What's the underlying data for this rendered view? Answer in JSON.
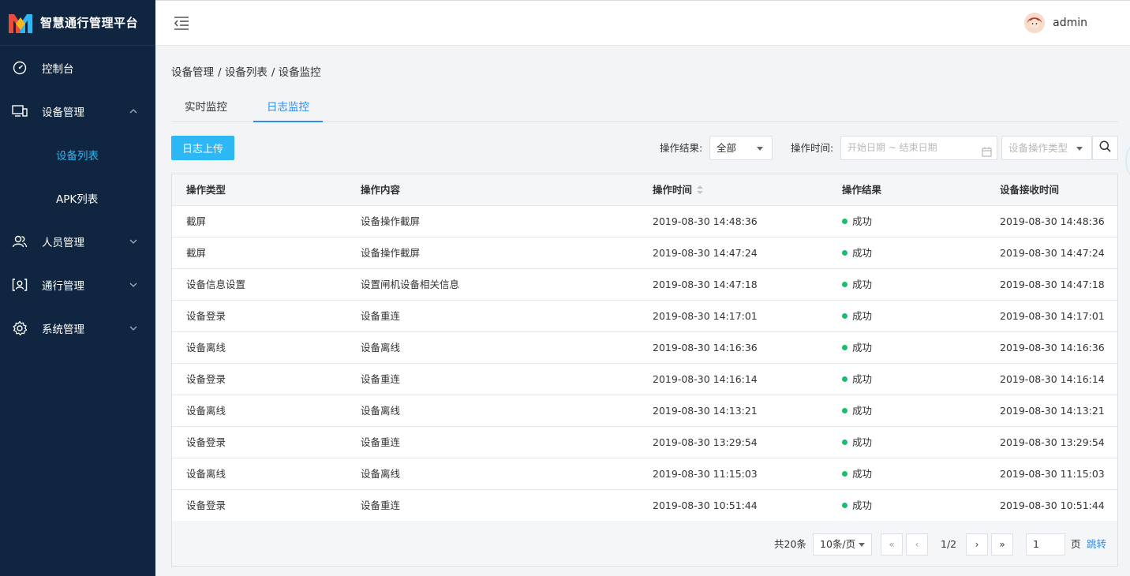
{
  "app": {
    "title": "智慧通行管理平台"
  },
  "sidebar": {
    "items": [
      {
        "label": "控制台",
        "icon": "dashboard-icon"
      },
      {
        "label": "设备管理",
        "icon": "devices-icon",
        "expanded": true,
        "children": [
          {
            "label": "设备列表",
            "active": true
          },
          {
            "label": "APK列表"
          }
        ]
      },
      {
        "label": "人员管理",
        "icon": "people-icon"
      },
      {
        "label": "通行管理",
        "icon": "access-icon"
      },
      {
        "label": "系统管理",
        "icon": "gear-icon"
      }
    ]
  },
  "header": {
    "user": "admin"
  },
  "breadcrumb": [
    "设备管理",
    "/ 设备列表",
    "/ 设备监控"
  ],
  "tabs": [
    {
      "label": "实时监控"
    },
    {
      "label": "日志监控",
      "active": true
    }
  ],
  "toolbar": {
    "upload_label": "日志上传",
    "result_label": "操作结果:",
    "result_value": "全部",
    "time_label": "操作时间:",
    "date_placeholder": "开始日期 ~ 结束日期",
    "type_placeholder": "设备操作类型"
  },
  "table": {
    "headers": [
      "操作类型",
      "操作内容",
      "操作时间",
      "操作结果",
      "设备接收时间"
    ],
    "rows": [
      [
        "截屏",
        "设备操作截屏",
        "2019-08-30 14:48:36",
        "成功",
        "2019-08-30 14:48:36"
      ],
      [
        "截屏",
        "设备操作截屏",
        "2019-08-30 14:47:24",
        "成功",
        "2019-08-30 14:47:24"
      ],
      [
        "设备信息设置",
        "设置闸机设备相关信息",
        "2019-08-30 14:47:18",
        "成功",
        "2019-08-30 14:47:18"
      ],
      [
        "设备登录",
        "设备重连",
        "2019-08-30 14:17:01",
        "成功",
        "2019-08-30 14:17:01"
      ],
      [
        "设备离线",
        "设备离线",
        "2019-08-30 14:16:36",
        "成功",
        "2019-08-30 14:16:36"
      ],
      [
        "设备登录",
        "设备重连",
        "2019-08-30 14:16:14",
        "成功",
        "2019-08-30 14:16:14"
      ],
      [
        "设备离线",
        "设备离线",
        "2019-08-30 14:13:21",
        "成功",
        "2019-08-30 14:13:21"
      ],
      [
        "设备登录",
        "设备重连",
        "2019-08-30 13:29:54",
        "成功",
        "2019-08-30 13:29:54"
      ],
      [
        "设备离线",
        "设备离线",
        "2019-08-30 11:15:03",
        "成功",
        "2019-08-30 11:15:03"
      ],
      [
        "设备登录",
        "设备重连",
        "2019-08-30 10:51:44",
        "成功",
        "2019-08-30 10:51:44"
      ]
    ]
  },
  "pagination": {
    "total": "共20条",
    "page_size": "10条/页",
    "first": "«",
    "prev": "‹",
    "current": "1/2",
    "next": "›",
    "last": "»",
    "jump_value": "1",
    "unit": "页",
    "jump_label": "跳转"
  },
  "colors": {
    "sidebar_bg": "#0f2540",
    "accent": "#2db7f5",
    "link": "#2d8cf0",
    "success": "#19be6b"
  }
}
